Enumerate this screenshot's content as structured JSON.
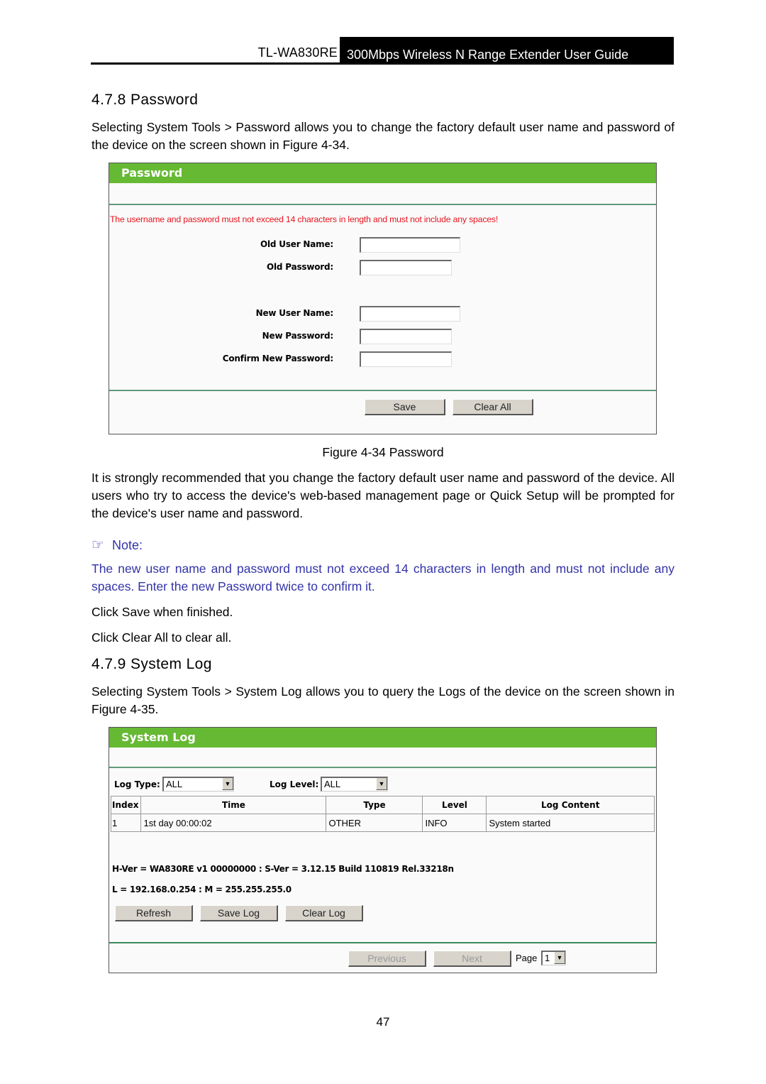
{
  "header": {
    "model": "TL-WA830RE",
    "guide_title": "300Mbps Wireless N Range Extender User Guide"
  },
  "section_password": {
    "heading": "4.7.8 Password",
    "intro": "Selecting System Tools > Password allows you to change the factory default user name and password of the device on the screen shown in Figure 4-34.",
    "panel": {
      "title": "Password",
      "warning": "The username and password must not exceed 14 characters in length and must not include any spaces!",
      "fields": [
        {
          "label": "Old User Name:",
          "value": ""
        },
        {
          "label": "Old Password:",
          "value": ""
        },
        {
          "label": "New User Name:",
          "value": ""
        },
        {
          "label": "New Password:",
          "value": ""
        },
        {
          "label": "Confirm New Password:",
          "value": ""
        }
      ],
      "save_label": "Save",
      "clear_all_label": "Clear All"
    },
    "caption": "Figure 4-34 Password",
    "recommendation": "It is strongly recommended that you change the factory default user name and password of the device. All users who try to access the device's web-based management page or Quick Setup will be prompted for the device's user name and password.",
    "note_label": "Note:",
    "note_icon": "pointing-hand-icon",
    "note_text": "The new user name and password must not exceed 14 characters in length and must not include any spaces. Enter the new Password twice to confirm it.",
    "note_color": "#3333aa",
    "click_save": "Click Save when finished.",
    "click_clear": "Click Clear All to clear all."
  },
  "section_syslog": {
    "heading": "4.7.9 System Log",
    "intro": "Selecting System Tools > System Log allows you to query the Logs of the device on the screen shown in Figure 4-35.",
    "panel": {
      "title": "System Log",
      "log_type_label": "Log Type:",
      "log_type_value": "ALL",
      "log_level_label": "Log Level:",
      "log_level_value": "ALL",
      "columns": [
        "Index",
        "Time",
        "Type",
        "Level",
        "Log Content"
      ],
      "rows": [
        [
          "1",
          "1st day 00:00:02",
          "OTHER",
          "INFO",
          "System started"
        ]
      ],
      "hw_sw_line": "H-Ver = WA830RE v1 00000000 : S-Ver = 3.12.15 Build 110819 Rel.33218n",
      "lan_line": "L = 192.168.0.254 : M = 255.255.255.0",
      "refresh_label": "Refresh",
      "save_log_label": "Save Log",
      "clear_log_label": "Clear Log",
      "previous_label": "Previous",
      "next_label": "Next",
      "page_label": "Page",
      "page_value": "1"
    }
  },
  "colors": {
    "panel_title_bg": "#66b933",
    "warning_text": "#e8141e",
    "divider": "#5f9a7a"
  },
  "page_number": "47"
}
